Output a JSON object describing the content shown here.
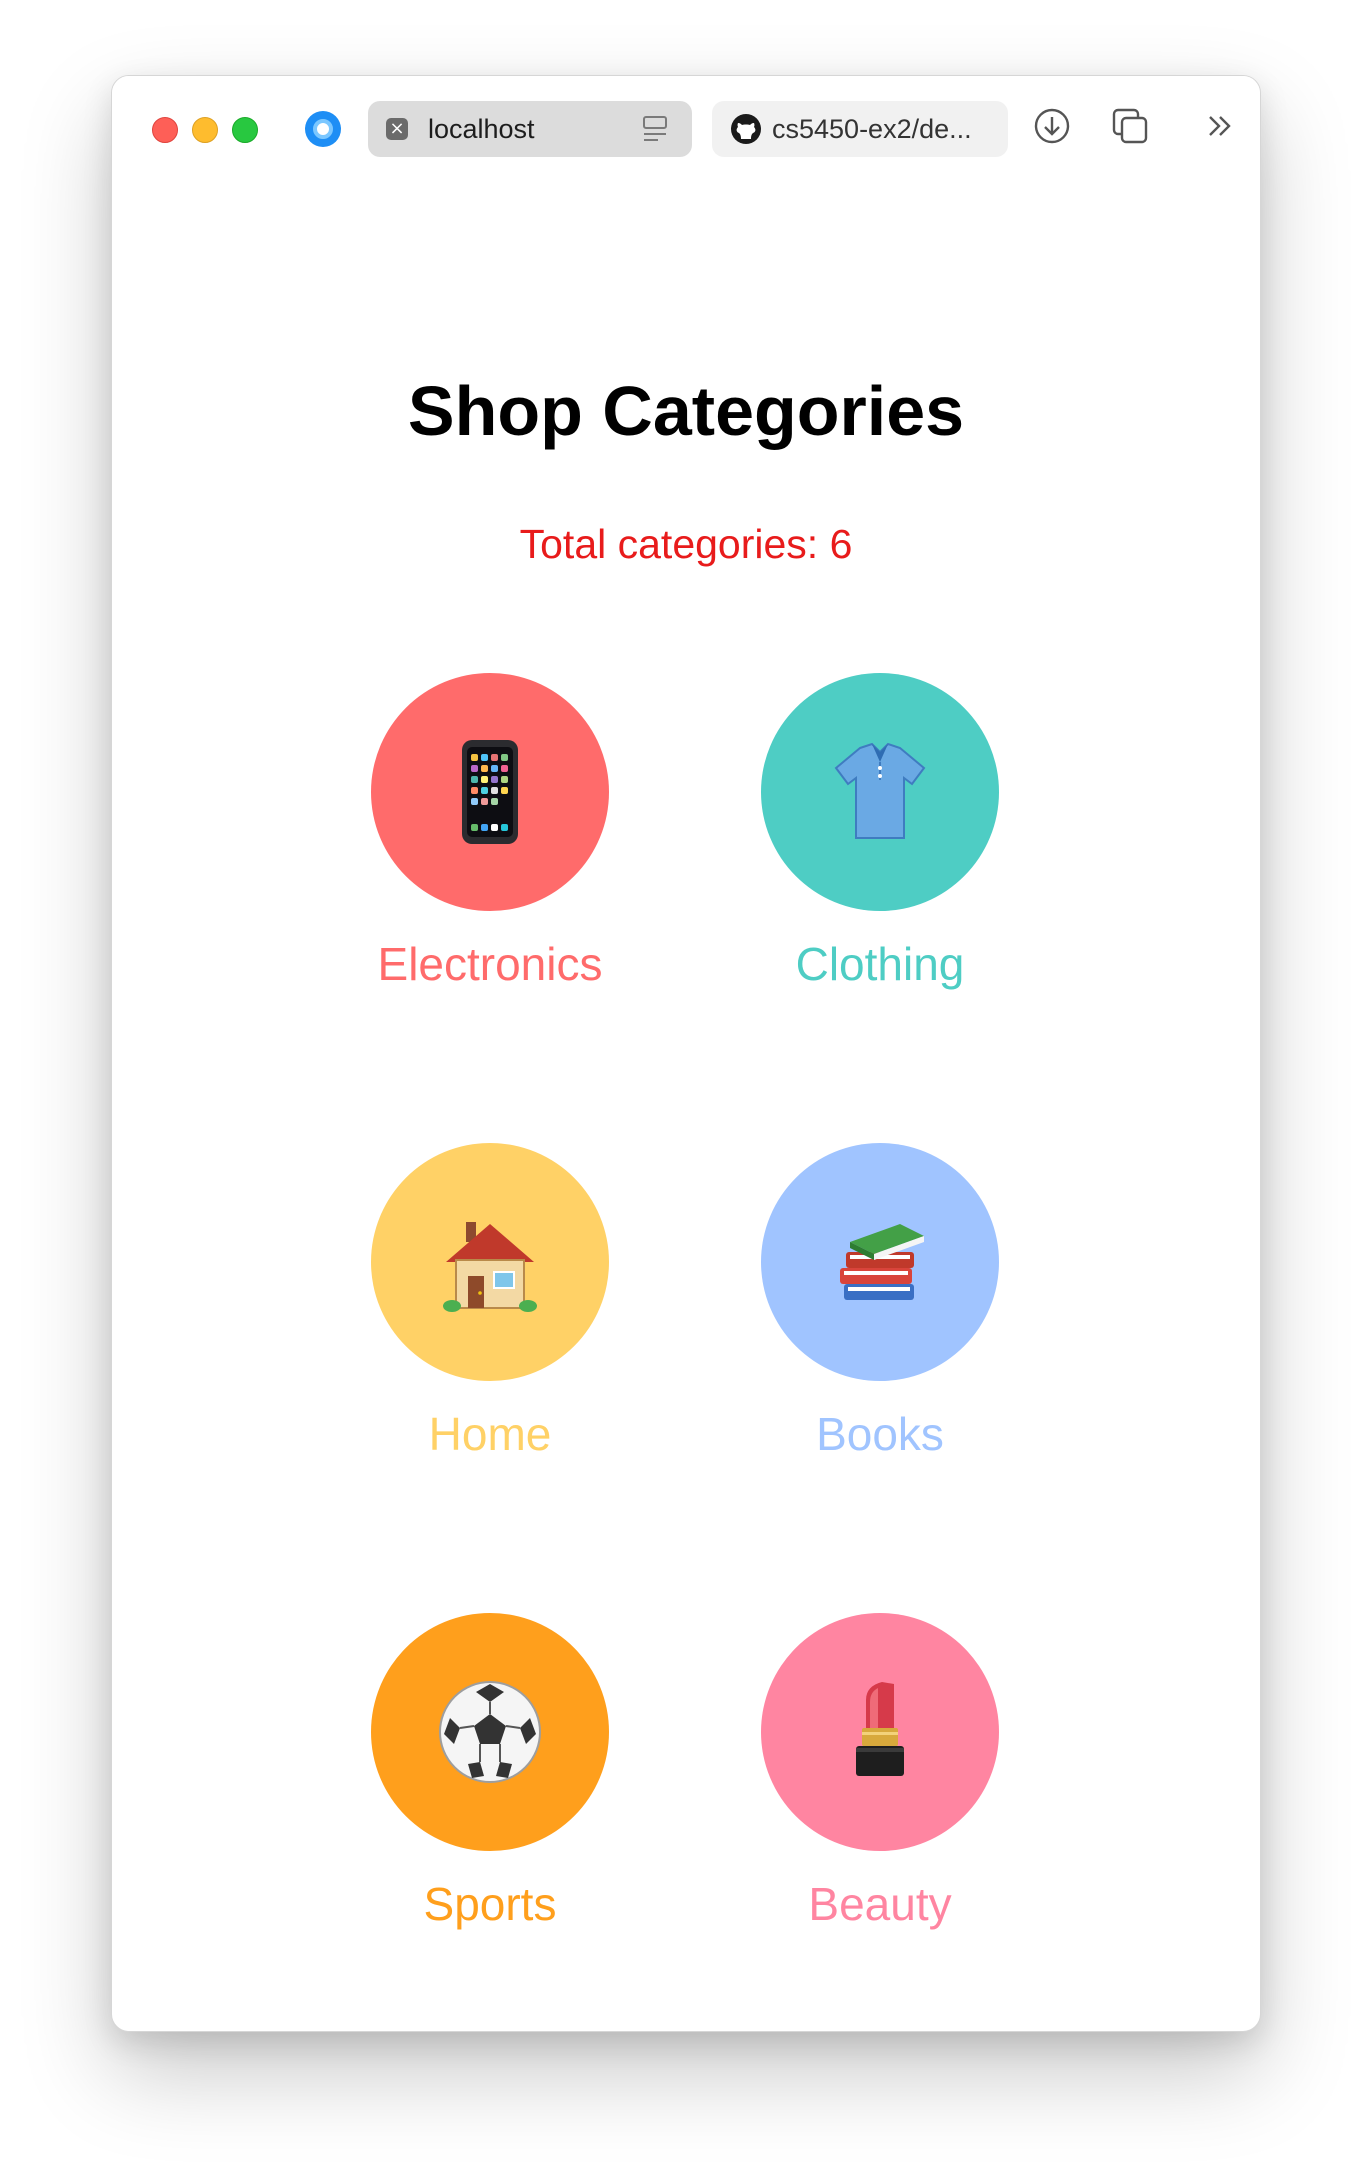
{
  "browser": {
    "tabs": [
      {
        "label": "localhost",
        "active": true
      },
      {
        "label": "cs5450-ex2/de...",
        "active": false
      }
    ]
  },
  "page": {
    "title": "Shop Categories",
    "total_text": "Total categories: 6",
    "categories": [
      {
        "name": "Electronics",
        "icon": "mobile-phone-icon",
        "color": "#ff6b6b"
      },
      {
        "name": "Clothing",
        "icon": "polo-shirt-icon",
        "color": "#4ecdc4"
      },
      {
        "name": "Home",
        "icon": "house-icon",
        "color": "#ffd166"
      },
      {
        "name": "Books",
        "icon": "books-icon",
        "color": "#a0c4ff"
      },
      {
        "name": "Sports",
        "icon": "soccer-ball-icon",
        "color": "#ff9f1c"
      },
      {
        "name": "Beauty",
        "icon": "lipstick-icon",
        "color": "#ff85a1"
      }
    ]
  },
  "colors": {
    "total_text": "#e81b1b",
    "title": "#000000"
  }
}
